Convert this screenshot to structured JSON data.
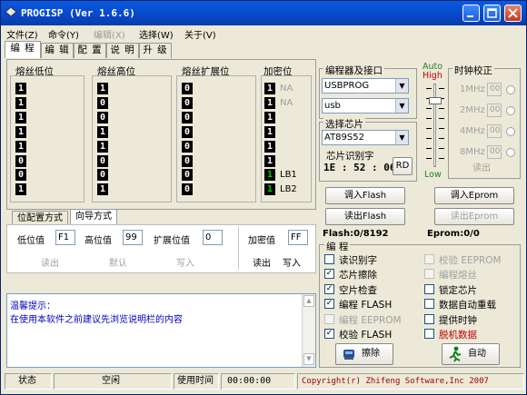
{
  "titlebar": {
    "title": "PROGISP (Ver 1.6.6)",
    "minimize_icon": "minimize-icon",
    "maximize_icon": "maximize-icon",
    "close_icon": "close-icon"
  },
  "menu": [
    "文件(Z)",
    "命令(Y)",
    "编辑(X)",
    "选择(W)",
    "关于(V)"
  ],
  "tabs": [
    "编 程",
    "编 辑",
    "配 置",
    "说 明",
    "升 级"
  ],
  "fuses": {
    "low": {
      "title": "熔丝低位",
      "bits": [
        "1",
        "1",
        "1",
        "1",
        "1",
        "0",
        "0",
        "1"
      ]
    },
    "high": {
      "title": "熔丝高位",
      "bits": [
        "1",
        "0",
        "0",
        "1",
        "1",
        "0",
        "0",
        "1"
      ]
    },
    "ext": {
      "title": "熔丝扩展位",
      "bits": [
        "0",
        "0",
        "0",
        "0",
        "0",
        "0",
        "0",
        "0"
      ]
    },
    "lock": {
      "title": "加密位",
      "bits": [
        "1",
        "1",
        "1",
        "1",
        "1",
        "1",
        "1",
        "1"
      ],
      "labels": [
        "NA",
        "NA",
        "",
        "",
        "",
        "",
        "LB1",
        "LB2"
      ]
    }
  },
  "fuse_tabs": [
    "位配置方式",
    "向导方式"
  ],
  "fuse_values": {
    "low_label": "低位值",
    "low": "F1",
    "high_label": "高位值",
    "high": "99",
    "ext_label": "扩展位值",
    "ext": "0",
    "lock_label": "加密值",
    "lock": "FF"
  },
  "fuse_buttons": {
    "read": "读出",
    "default": "默认",
    "write": "写入",
    "lock_read": "读出",
    "lock_write": "写入"
  },
  "messages": {
    "title": "温馨提示：",
    "body": "在使用本软件之前建议先浏览说明栏的内容"
  },
  "programmer": {
    "group": "编程器及接口",
    "device": "USBPROG",
    "port": "usb"
  },
  "chip": {
    "group": "选择芯片",
    "name": "AT89S52",
    "id_label": "芯片识别字",
    "id": "1E : 52 : 06",
    "rd": "RD"
  },
  "speed": {
    "auto": "Auto",
    "high": "High",
    "low": "Low"
  },
  "clock": {
    "title": "时钟校正",
    "rows": [
      "1MHz",
      "2MHz",
      "4MHz",
      "8MHz"
    ],
    "values": [
      "00",
      "00",
      "00",
      "00"
    ],
    "read": "读出"
  },
  "buffers": {
    "load_flash": "调入Flash",
    "read_flash": "读出Flash",
    "load_eprom": "调入Eprom",
    "read_eprom": "读出Eprom",
    "flash_info": "Flash:0/8192",
    "eprom_info": "Eprom:0/0"
  },
  "program": {
    "group": "编 程",
    "left": [
      {
        "label": "读识别字",
        "checked": false,
        "enabled": true
      },
      {
        "label": "芯片擦除",
        "checked": true,
        "enabled": true
      },
      {
        "label": "空片检查",
        "checked": true,
        "enabled": true
      },
      {
        "label": "编程 FLASH",
        "checked": true,
        "enabled": true
      },
      {
        "label": "编程 EEPROM",
        "checked": false,
        "enabled": false
      },
      {
        "label": "校验 FLASH",
        "checked": true,
        "enabled": true
      }
    ],
    "right": [
      {
        "label": "校验 EEPROM",
        "checked": false,
        "enabled": false
      },
      {
        "label": "编程熔丝",
        "checked": false,
        "enabled": false
      },
      {
        "label": "锁定芯片",
        "checked": false,
        "enabled": true
      },
      {
        "label": "数据自动重载",
        "checked": false,
        "enabled": true
      },
      {
        "label": "提供时钟",
        "checked": false,
        "enabled": true
      },
      {
        "label": "脱机数据",
        "checked": false,
        "enabled": true
      }
    ],
    "erase": "擦除",
    "auto": "自动",
    "accent_red": "#c00000"
  },
  "statusbar": {
    "state_label": "状态",
    "state": "空闲",
    "time_label": "使用时间",
    "time": "00:00:00",
    "copyright": "Copyright(r) Zhifeng Software,Inc 2007"
  }
}
